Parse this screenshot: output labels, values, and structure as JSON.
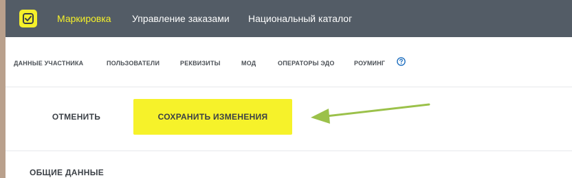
{
  "header": {
    "logo_icon": "checkmark-logo-icon",
    "nav": [
      {
        "label": "Маркировка",
        "active": true
      },
      {
        "label": "Управление заказами",
        "active": false
      },
      {
        "label": "Национальный каталог",
        "active": false
      }
    ]
  },
  "tabs": [
    {
      "label": "ДАННЫЕ УЧАСТНИКА"
    },
    {
      "label": "ПОЛЬЗОВАТЕЛИ"
    },
    {
      "label": "РЕКВИЗИТЫ"
    },
    {
      "label": "МОД"
    },
    {
      "label": "ОПЕРАТОРЫ ЭДО"
    },
    {
      "label": "РОУМИНГ",
      "icon": "question-circle-icon"
    }
  ],
  "actions": {
    "cancel_label": "ОТМЕНИТЬ",
    "save_label": "СОХРАНИТЬ ИЗМЕНЕНИЯ"
  },
  "annotation": {
    "icon": "green-arrow-icon",
    "color": "#9bc14a"
  },
  "section": {
    "title": "ОБЩИЕ ДАННЫЕ"
  },
  "colors": {
    "accent_yellow": "#f6f22a",
    "header_bg": "#535c66",
    "help_blue": "#1f6fbf"
  }
}
